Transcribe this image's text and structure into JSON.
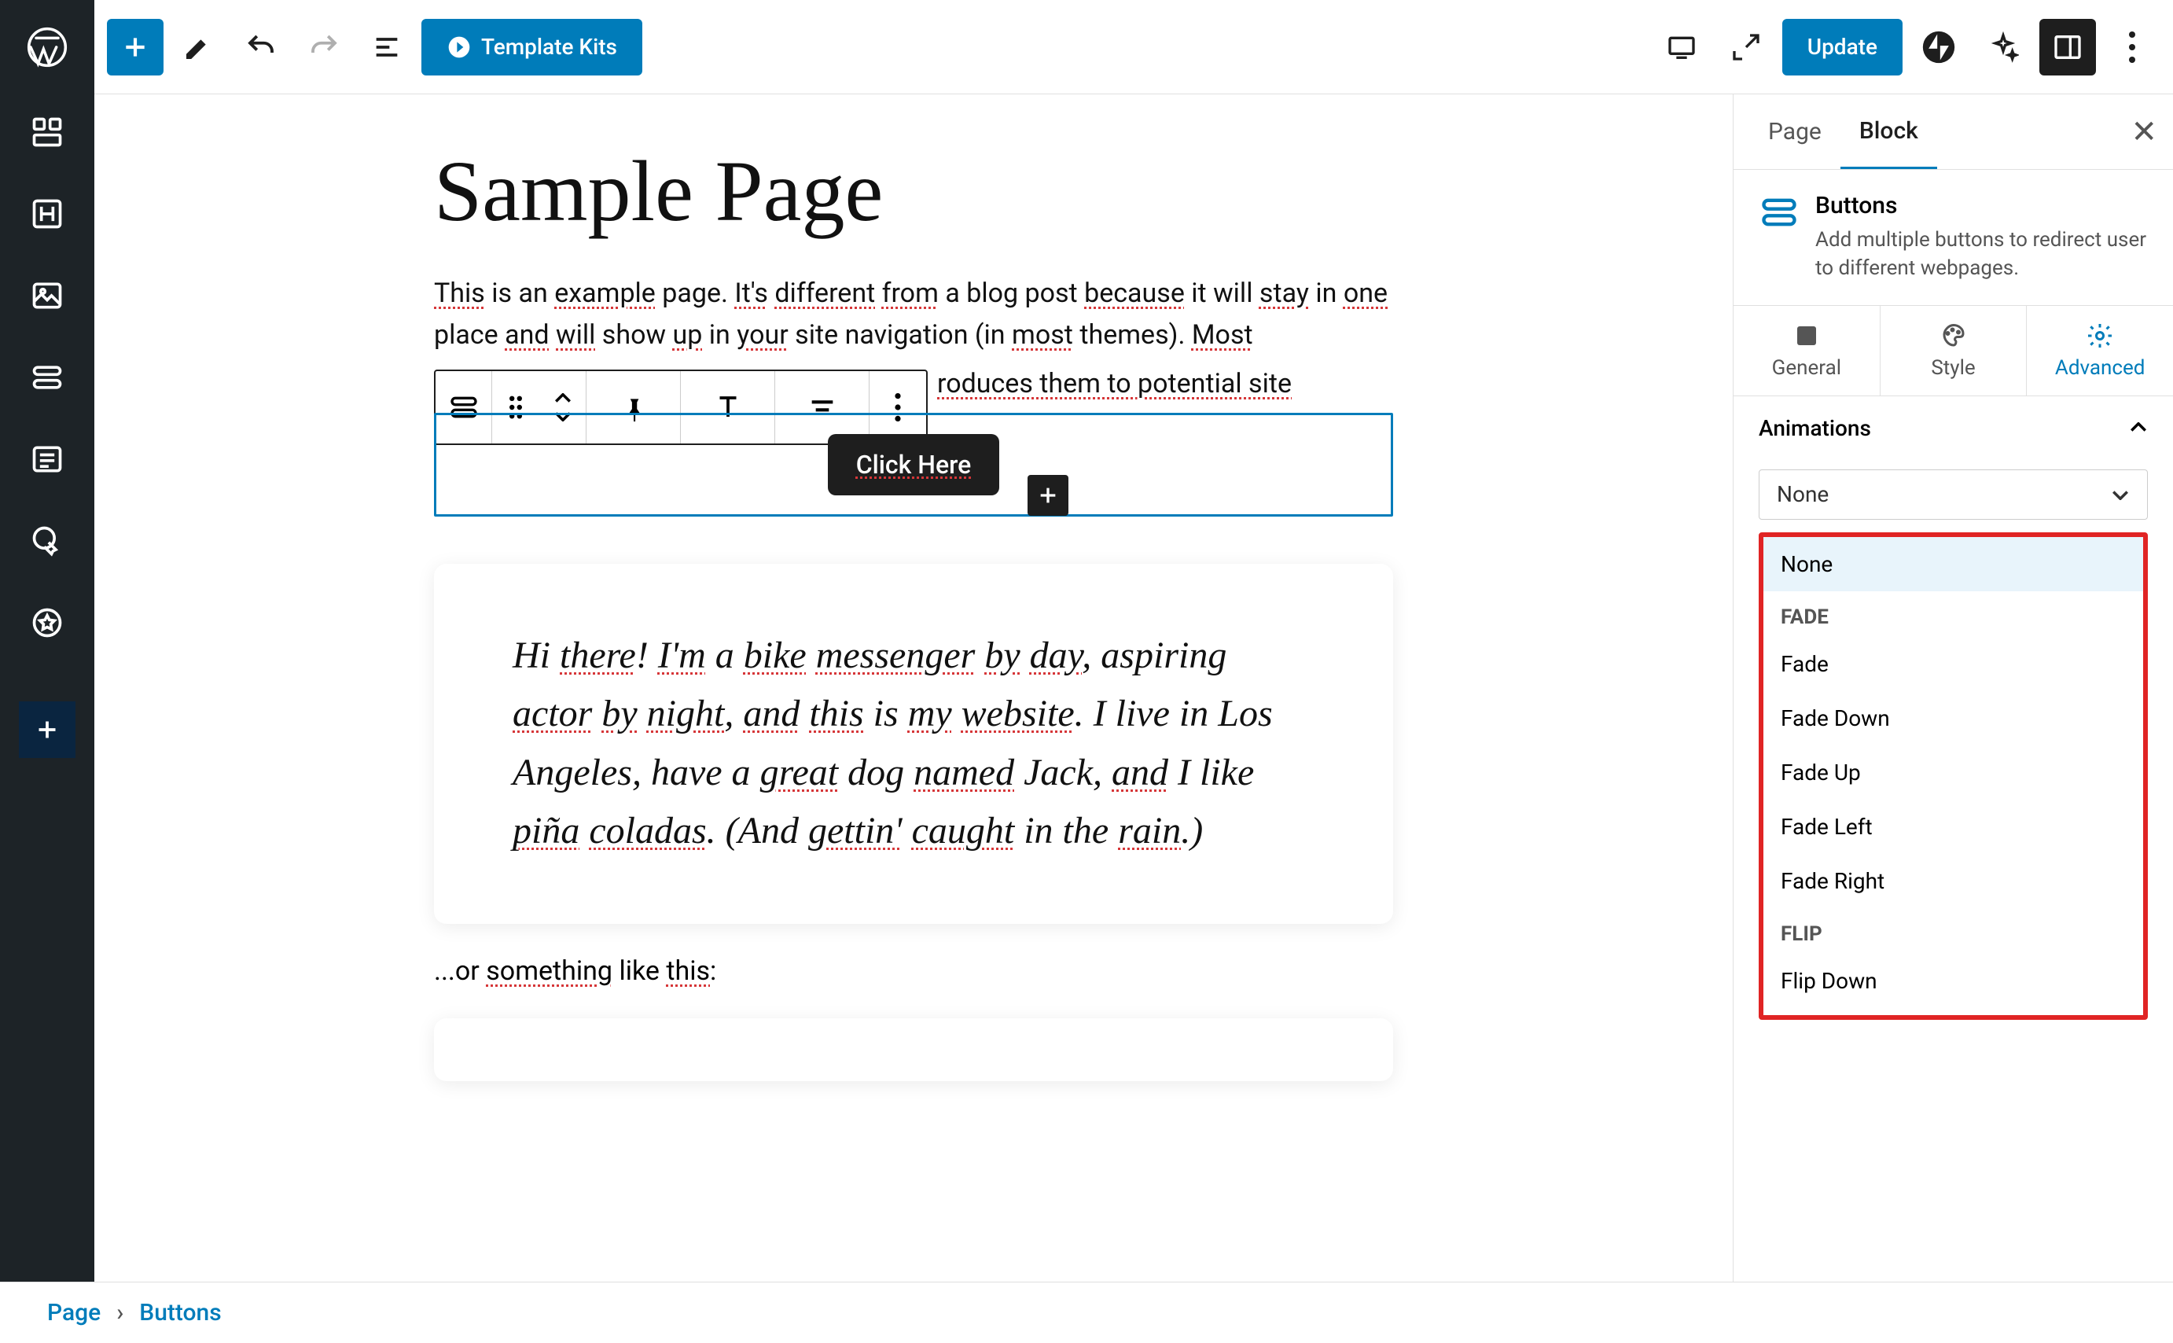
{
  "topbar": {
    "template_kits": "Template Kits",
    "update": "Update"
  },
  "page": {
    "title": "Sample Page",
    "para1_parts": [
      "This",
      " is an ",
      "example",
      " page. ",
      "It's",
      " ",
      "different",
      " ",
      "from",
      " a blog post ",
      "because",
      " it will ",
      "stay",
      " in ",
      "one",
      " place ",
      "and",
      " ",
      "will",
      " show ",
      "up",
      " in ",
      "your",
      " site navigation (in ",
      "most",
      " themes). ",
      "Most"
    ],
    "para2_tail": "roduces them to potential site",
    "button_label": "Click Here",
    "quote_parts": [
      "Hi ",
      "there",
      "! ",
      "I'm",
      " a ",
      "bike",
      " ",
      "messenger",
      " ",
      "by",
      " ",
      "day",
      ", aspiring ",
      "actor",
      " ",
      "by",
      " ",
      "night",
      ", ",
      "and",
      " ",
      "this",
      " is ",
      "my",
      " ",
      "website",
      ". I live in Los Angeles, have a ",
      "great",
      " dog ",
      "named",
      " Jack, ",
      "and",
      " I like ",
      "piña",
      " ",
      "coladas",
      ". (And ",
      "gettin'",
      " ",
      "caught",
      " in the ",
      "rain",
      ".)"
    ],
    "or_parts": [
      "...or ",
      "something",
      " like ",
      "this",
      ":"
    ]
  },
  "sidebar": {
    "tabs": {
      "page": "Page",
      "block": "Block"
    },
    "block_title": "Buttons",
    "block_desc": "Add multiple buttons to redirect user to different webpages.",
    "subtabs": {
      "general": "General",
      "style": "Style",
      "advanced": "Advanced"
    },
    "section_animations": "Animations",
    "select_value": "None",
    "options": {
      "none": "None",
      "group_fade": "FADE",
      "fade": "Fade",
      "fade_down": "Fade Down",
      "fade_up": "Fade Up",
      "fade_left": "Fade Left",
      "fade_right": "Fade Right",
      "group_flip": "FLIP",
      "flip_down": "Flip Down"
    }
  },
  "footer": {
    "page": "Page",
    "block": "Buttons"
  }
}
